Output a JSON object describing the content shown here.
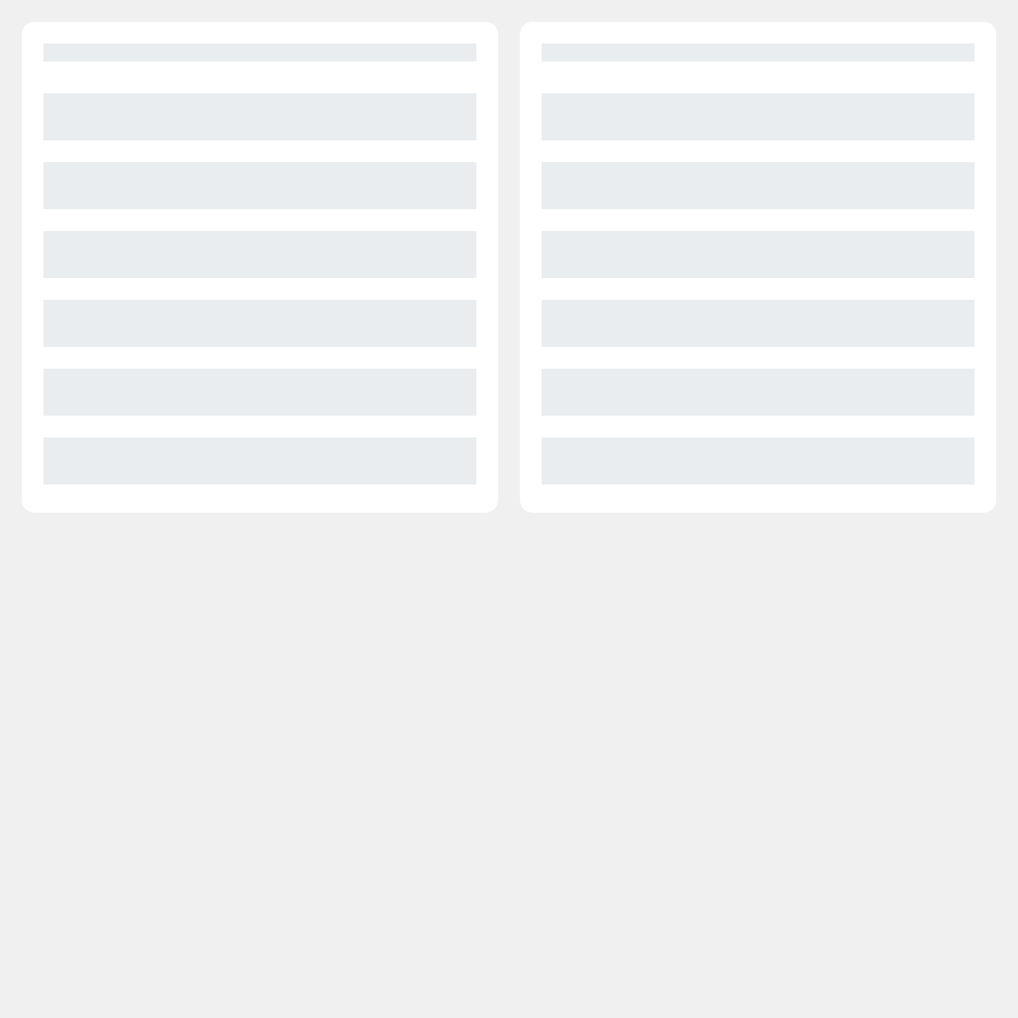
{
  "theme": {
    "page_background": "#f0f0f0",
    "panel_background": "#ffffff",
    "skeleton_color": "#e9edf0"
  },
  "panels": [
    {
      "skeleton_rows": 6
    },
    {
      "skeleton_rows": 6
    }
  ]
}
